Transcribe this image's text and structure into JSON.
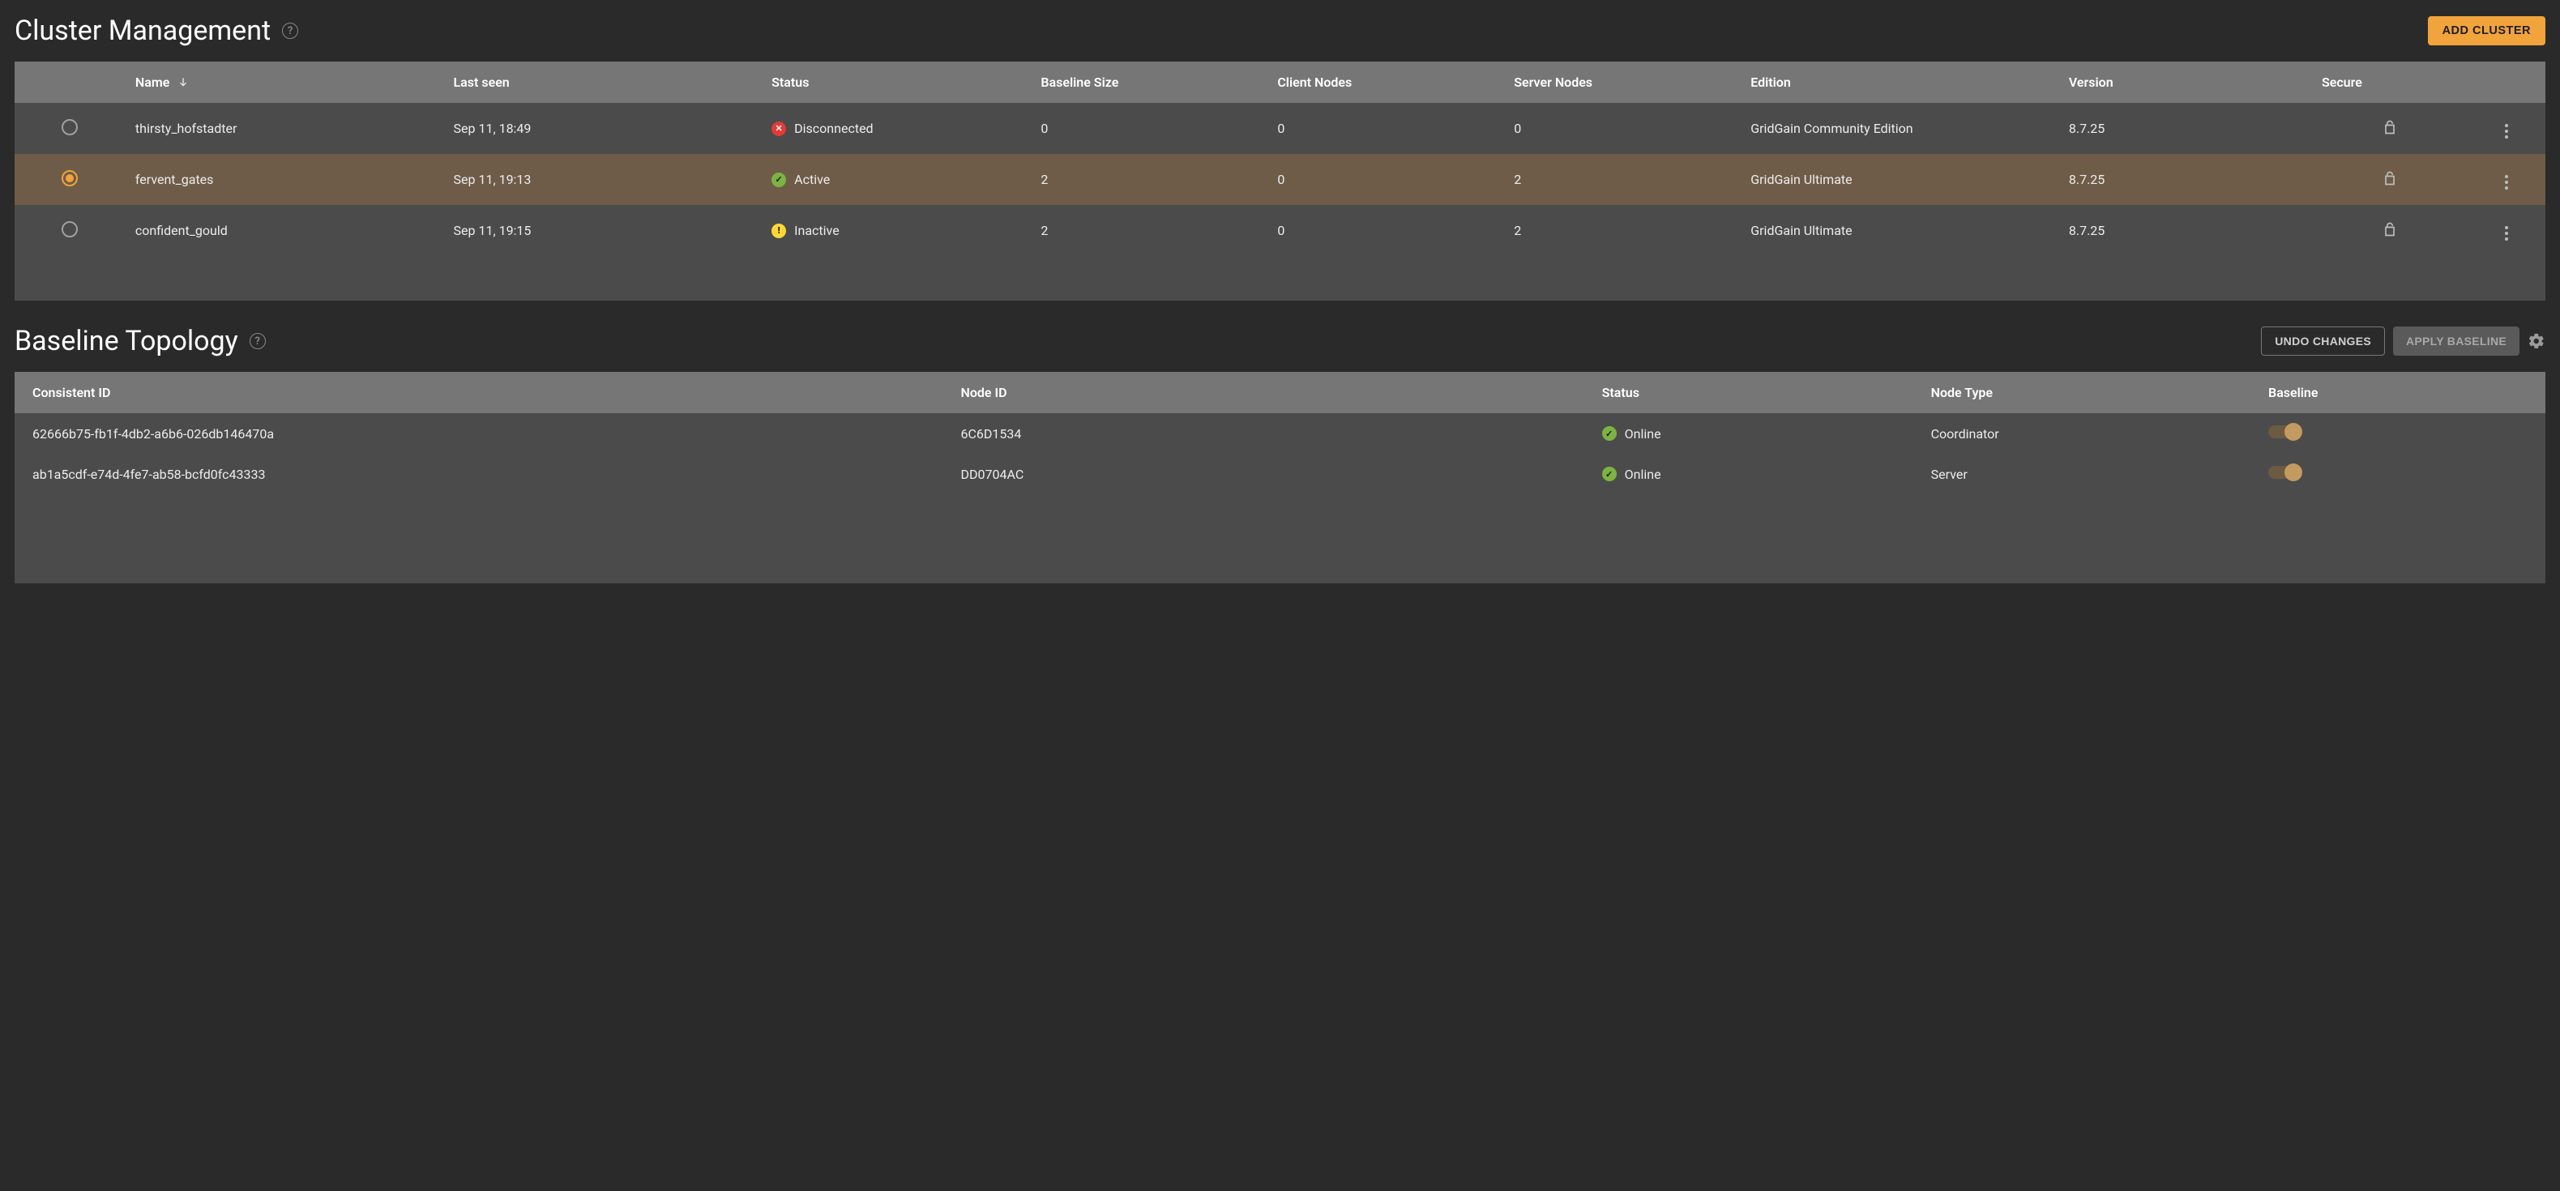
{
  "clusterSection": {
    "title": "Cluster Management",
    "addButton": "ADD CLUSTER",
    "columns": {
      "name": "Name",
      "lastSeen": "Last seen",
      "status": "Status",
      "baselineSize": "Baseline Size",
      "clientNodes": "Client Nodes",
      "serverNodes": "Server Nodes",
      "edition": "Edition",
      "version": "Version",
      "secure": "Secure"
    },
    "rows": [
      {
        "selected": false,
        "name": "thirsty_hofstadter",
        "lastSeen": "Sep 11, 18:49",
        "status": "Disconnected",
        "statusColor": "red",
        "baselineSize": "0",
        "clientNodes": "0",
        "serverNodes": "0",
        "edition": "GridGain Community Edition",
        "version": "8.7.25"
      },
      {
        "selected": true,
        "name": "fervent_gates",
        "lastSeen": "Sep 11, 19:13",
        "status": "Active",
        "statusColor": "green",
        "baselineSize": "2",
        "clientNodes": "0",
        "serverNodes": "2",
        "edition": "GridGain Ultimate",
        "version": "8.7.25"
      },
      {
        "selected": false,
        "name": "confident_gould",
        "lastSeen": "Sep 11, 19:15",
        "status": "Inactive",
        "statusColor": "yellow",
        "baselineSize": "2",
        "clientNodes": "0",
        "serverNodes": "2",
        "edition": "GridGain Ultimate",
        "version": "8.7.25"
      }
    ]
  },
  "baselineSection": {
    "title": "Baseline Topology",
    "undoButton": "UNDO CHANGES",
    "applyButton": "APPLY BASELINE",
    "columns": {
      "consistentId": "Consistent ID",
      "nodeId": "Node ID",
      "status": "Status",
      "nodeType": "Node Type",
      "baseline": "Baseline"
    },
    "rows": [
      {
        "consistentId": "62666b75-fb1f-4db2-a6b6-026db146470a",
        "nodeId": "6C6D1534",
        "status": "Online",
        "statusColor": "green",
        "nodeType": "Coordinator",
        "baseline": true
      },
      {
        "consistentId": "ab1a5cdf-e74d-4fe7-ab58-bcfd0fc43333",
        "nodeId": "DD0704AC",
        "status": "Online",
        "statusColor": "green",
        "nodeType": "Server",
        "baseline": true
      }
    ]
  },
  "icons": {
    "statusGlyph": {
      "green": "✓",
      "red": "✕",
      "yellow": "!"
    }
  }
}
